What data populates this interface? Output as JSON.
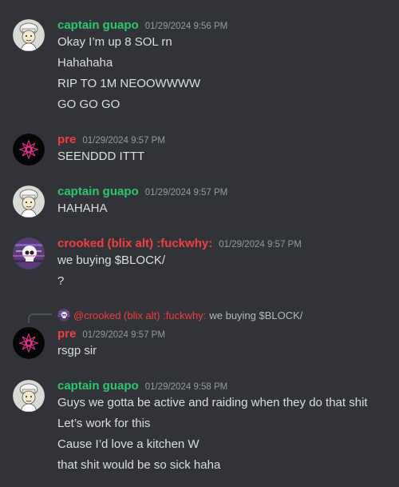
{
  "colors": {
    "background": "#313338",
    "username_green": "#2dc770",
    "username_red": "#f23f42",
    "timestamp": "#949ba4",
    "text": "#dbdee1"
  },
  "messages": [
    {
      "author": "captain guapo",
      "timestamp": "01/29/2024 9:56 PM",
      "avatar_icon": "cartoon-chef-avatar-icon",
      "lines": [
        "Okay I’m up 8 SOL rn",
        "Hahahaha",
        "RIP TO 1M NEOOWWWW",
        "GO GO GO"
      ]
    },
    {
      "author": "pre",
      "timestamp": "01/29/2024 9:57 PM",
      "avatar_icon": "pink-mandala-avatar-icon",
      "lines": [
        "SEENDDD ITTT"
      ]
    },
    {
      "author": "captain guapo",
      "timestamp": "01/29/2024 9:57 PM",
      "avatar_icon": "cartoon-chef-avatar-icon",
      "lines": [
        "HAHAHA"
      ]
    },
    {
      "author": "crooked (blix alt) :fuckwhy:",
      "timestamp": "01/29/2024 9:57 PM",
      "avatar_icon": "glitch-skull-avatar-icon",
      "lines": [
        "we buying $BLOCK/",
        "?"
      ]
    },
    {
      "author": "pre",
      "timestamp": "01/29/2024 9:57 PM",
      "avatar_icon": "pink-mandala-avatar-icon",
      "reply": {
        "author": "@crooked (blix alt) :fuckwhy:",
        "text": "we buying $BLOCK/"
      },
      "lines": [
        "rsgp sir"
      ]
    },
    {
      "author": "captain guapo",
      "timestamp": "01/29/2024 9:58 PM",
      "avatar_icon": "cartoon-chef-avatar-icon",
      "lines": [
        "Guys we gotta be active and raiding when they do that shit",
        "Let’s work for this",
        "Cause I’d love a kitchen W",
        "that shit would be so sick haha"
      ]
    }
  ]
}
